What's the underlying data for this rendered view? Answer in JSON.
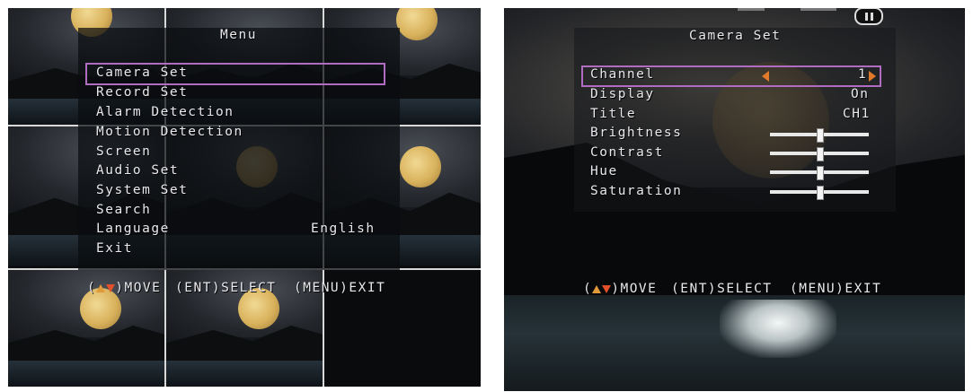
{
  "menu": {
    "title": "Menu",
    "items": [
      {
        "label": "Camera Set"
      },
      {
        "label": "Record Set"
      },
      {
        "label": "Alarm Detection"
      },
      {
        "label": "Motion Detection"
      },
      {
        "label": "Screen"
      },
      {
        "label": "Audio Set"
      },
      {
        "label": "System Set"
      },
      {
        "label": "Search"
      },
      {
        "label": "Language",
        "value": "English"
      },
      {
        "label": "Exit"
      }
    ],
    "selected_index": 0,
    "footer": {
      "move": ")MOVE",
      "open": "(",
      "select": "(ENT)SELECT",
      "exit": "(MENU)EXIT"
    }
  },
  "camera_set": {
    "title": "Camera Set",
    "rows": [
      {
        "label": "Channel",
        "value": "1"
      },
      {
        "label": "Display",
        "value": "On"
      },
      {
        "label": "Title",
        "value": "CH1"
      },
      {
        "label": "Brightness",
        "level": 0.5
      },
      {
        "label": "Contrast",
        "level": 0.5
      },
      {
        "label": "Hue",
        "level": 0.5
      },
      {
        "label": "Saturation",
        "level": 0.5
      }
    ],
    "selected_index": 0,
    "footer": {
      "move": ")MOVE",
      "open": "(",
      "select": "(ENT)SELECT",
      "exit": "(MENU)EXIT"
    }
  },
  "colors": {
    "selection_border": "#b06cc0",
    "arrow_up": "#e09a3a",
    "arrow_down": "#e0502a",
    "text": "#e9e9ee"
  },
  "icons": [
    "arrow-up-icon",
    "arrow-down-icon",
    "arrow-left-icon",
    "arrow-right-icon",
    "recording-icon"
  ]
}
